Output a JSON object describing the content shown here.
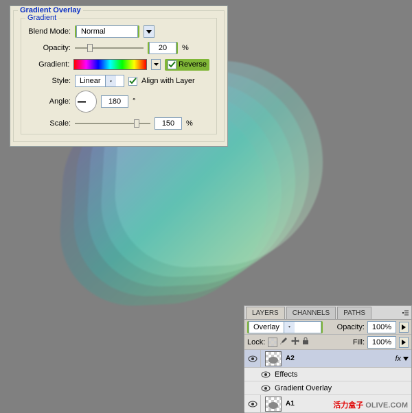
{
  "gradient_overlay": {
    "title": "Gradient Overlay",
    "section": "Gradient",
    "blend_mode": {
      "label": "Blend Mode:",
      "value": "Normal"
    },
    "opacity": {
      "label": "Opacity:",
      "value": "20",
      "suffix": "%"
    },
    "gradient": {
      "label": "Gradient:",
      "reverse_label": "Reverse",
      "reverse_checked": true
    },
    "style": {
      "label": "Style:",
      "value": "Linear",
      "align_label": "Align with Layer",
      "align_checked": true
    },
    "angle": {
      "label": "Angle:",
      "value": "180",
      "suffix": "°"
    },
    "scale": {
      "label": "Scale:",
      "value": "150",
      "suffix": "%"
    }
  },
  "layers_panel": {
    "tabs": [
      "LAYERS",
      "CHANNELS",
      "PATHS"
    ],
    "blend": {
      "value": "Overlay",
      "opacity_label": "Opacity:",
      "opacity_value": "100%"
    },
    "lock": {
      "label": "Lock:",
      "fill_label": "Fill:",
      "fill_value": "100%"
    },
    "items": [
      {
        "name": "A2",
        "visible": true,
        "fx": true,
        "expanded": true,
        "sub": [
          "Effects",
          "Gradient Overlay"
        ]
      },
      {
        "name": "A1",
        "visible": true
      }
    ]
  },
  "watermark": {
    "cn": "活力盒子",
    "domain": "OLIVE.COM"
  },
  "ui_colors": {
    "highlight": "#7fb636",
    "panel": "#ece9d8",
    "layers_bg": "#d4d0c8"
  }
}
